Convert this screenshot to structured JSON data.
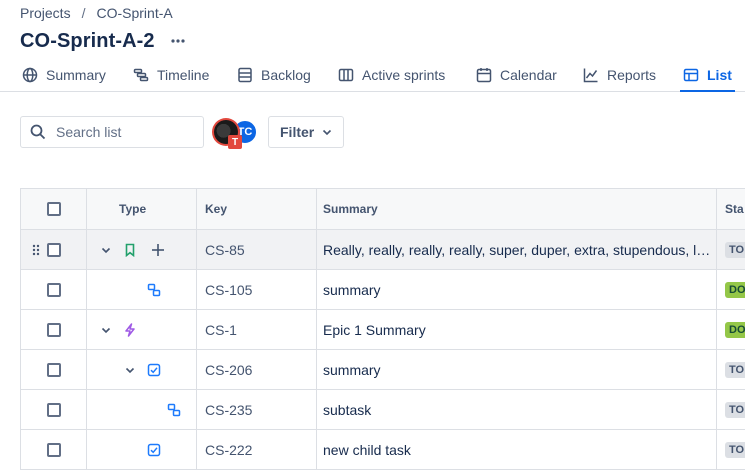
{
  "breadcrumb": {
    "projects": "Projects",
    "separator": "/",
    "current": "CO-Sprint-A"
  },
  "page": {
    "title": "CO-Sprint-A-2"
  },
  "tabs": [
    {
      "label": "Summary",
      "icon": "globe-icon"
    },
    {
      "label": "Timeline",
      "icon": "timeline-icon"
    },
    {
      "label": "Backlog",
      "icon": "backlog-icon"
    },
    {
      "label": "Active sprints",
      "icon": "board-icon"
    },
    {
      "label": "Calendar",
      "icon": "calendar-icon"
    },
    {
      "label": "Reports",
      "icon": "chart-icon"
    },
    {
      "label": "List",
      "icon": "list-icon",
      "active": true
    }
  ],
  "toolbar": {
    "search_placeholder": "Search list",
    "avatar_badge": "T",
    "avatar_initials": "TC",
    "filter_label": "Filter"
  },
  "table": {
    "columns": {
      "type": "Type",
      "key": "Key",
      "summary": "Summary",
      "status": "Sta"
    },
    "rows": [
      {
        "key": "CS-85",
        "summary": "Really, really, really, really, super, duper, extra, stupendous, long summary",
        "status": "TO DO",
        "type": "story-icon"
      },
      {
        "key": "CS-105",
        "summary": "summary",
        "status": "DONE",
        "type": "subtask-icon"
      },
      {
        "key": "CS-1",
        "summary": "Epic 1 Summary",
        "status": "DONE",
        "type": "epic-icon"
      },
      {
        "key": "CS-206",
        "summary": "summary",
        "status": "TO DO",
        "type": "task-icon"
      },
      {
        "key": "CS-235",
        "summary": "subtask",
        "status": "TO DO",
        "type": "subtask-icon"
      },
      {
        "key": "CS-222",
        "summary": "new child task",
        "status": "TO DO",
        "type": "task-icon"
      }
    ]
  },
  "colors": {
    "accent": "#0c66e4",
    "epic": "#9f5ae5",
    "story": "#22a06b",
    "task": "#1d7afc",
    "done_bg": "#94c748",
    "todo_bg": "#dcdfe4"
  }
}
